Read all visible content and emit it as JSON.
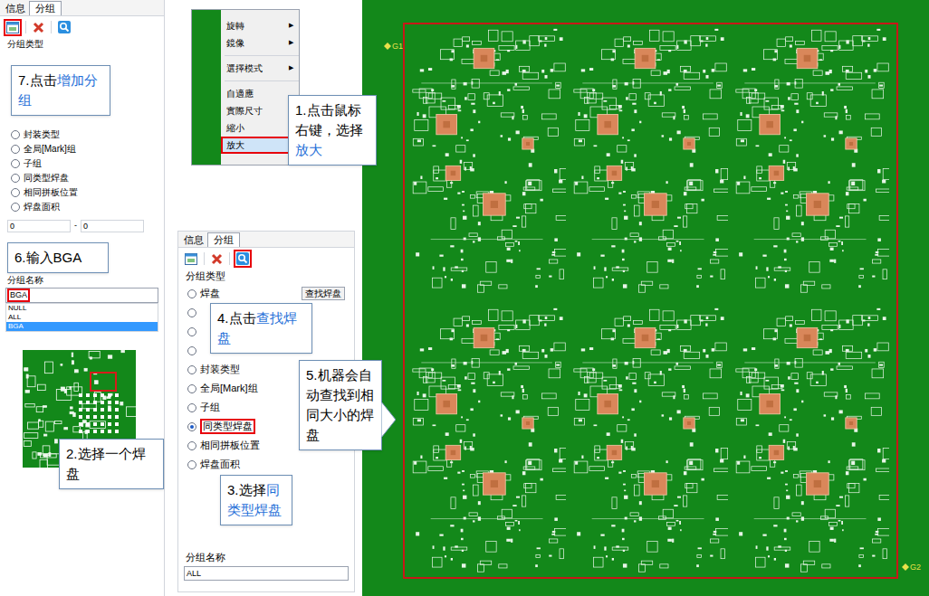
{
  "left_panel": {
    "tabs": [
      {
        "label": "信息",
        "selected": false
      },
      {
        "label": "分组",
        "selected": true
      }
    ],
    "toolbar": {
      "add_highlighted": true,
      "delete_highlighted": false,
      "search_highlighted": false
    },
    "group_type_label": "分组类型",
    "radios": [
      {
        "label": "封装类型",
        "selected": false
      },
      {
        "label": "全局[Mark]组",
        "selected": false
      },
      {
        "label": "子组",
        "selected": false
      },
      {
        "label": "同类型焊盘",
        "selected": false
      },
      {
        "label": "相同拼板位置",
        "selected": false
      },
      {
        "label": "焊盘面积",
        "selected": false
      }
    ],
    "area_range": {
      "min": "0",
      "separator": "-",
      "max": "0"
    },
    "group_name_label": "分组名称",
    "group_name_input": {
      "value": "BGA",
      "highlighted": true
    },
    "group_list": [
      {
        "label": "NULL",
        "selected": false
      },
      {
        "label": "ALL",
        "selected": false
      },
      {
        "label": "BGA",
        "selected": true
      }
    ],
    "thumbnail": {
      "highlighted": true
    }
  },
  "context_menu": {
    "items": [
      {
        "kind": "item",
        "label": "旋轉",
        "arrow": "▶",
        "selected": false
      },
      {
        "kind": "item",
        "label": "鏡像",
        "arrow": "▶",
        "selected": false
      },
      {
        "kind": "separator",
        "label": "",
        "arrow": "",
        "selected": false
      },
      {
        "kind": "item",
        "label": "選擇模式",
        "arrow": "▶",
        "selected": false
      },
      {
        "kind": "separator",
        "label": "",
        "arrow": "",
        "selected": false
      },
      {
        "kind": "item",
        "label": "自適應",
        "arrow": "",
        "selected": false
      },
      {
        "kind": "item",
        "label": "實際尺寸",
        "arrow": "",
        "selected": false
      },
      {
        "kind": "item",
        "label": "縮小",
        "arrow": "",
        "selected": false
      },
      {
        "kind": "item",
        "label": "放大",
        "arrow": "",
        "selected": true
      }
    ]
  },
  "middle_panel": {
    "tabs": [
      {
        "label": "信息",
        "selected": false
      },
      {
        "label": "分组",
        "selected": true
      }
    ],
    "toolbar": {
      "add_highlighted": false,
      "delete_highlighted": false,
      "search_highlighted": true
    },
    "group_type_label": "分组类型",
    "radios": [
      {
        "label": "焊盘",
        "selected": false,
        "highlighted": false,
        "button": "查找焊盘"
      },
      {
        "label": "",
        "selected": false,
        "highlighted": false,
        "button": ""
      },
      {
        "label": "",
        "selected": false,
        "highlighted": false,
        "button": ""
      },
      {
        "label": "",
        "selected": false,
        "highlighted": false,
        "button": ""
      },
      {
        "label": "封装类型",
        "selected": false,
        "highlighted": false,
        "button": ""
      },
      {
        "label": "全局[Mark]组",
        "selected": false,
        "highlighted": false,
        "button": ""
      },
      {
        "label": "子组",
        "selected": false,
        "highlighted": false,
        "button": ""
      },
      {
        "label": "同类型焊盘",
        "selected": true,
        "highlighted": true,
        "button": ""
      },
      {
        "label": "相同拼板位置",
        "selected": false,
        "highlighted": false,
        "button": ""
      },
      {
        "label": "焊盘面积",
        "selected": false,
        "highlighted": false,
        "button": ""
      }
    ],
    "group_name_label": "分组名称",
    "group_name_input": {
      "value": "ALL"
    }
  },
  "canvas": {
    "markers": [
      {
        "label": "G1"
      },
      {
        "label": "G2"
      }
    ]
  },
  "callouts": [
    {
      "parts": [
        {
          "text": "1.点击鼠标右键，选择",
          "highlight": false
        },
        {
          "text": "放大",
          "highlight": true
        }
      ]
    },
    {
      "parts": [
        {
          "text": "2.选择一个焊盘",
          "highlight": false
        }
      ]
    },
    {
      "parts": [
        {
          "text": "3.选择",
          "highlight": false
        },
        {
          "text": "同类型焊盘",
          "highlight": true
        }
      ]
    },
    {
      "parts": [
        {
          "text": "4.点击",
          "highlight": false
        },
        {
          "text": "查找焊盘",
          "highlight": true
        }
      ]
    },
    {
      "parts": [
        {
          "text": "5.机器会自动查找到相同大小的焊盘",
          "highlight": false
        }
      ]
    },
    {
      "parts": [
        {
          "text": "6.输入BGA",
          "highlight": false
        }
      ]
    },
    {
      "parts": [
        {
          "text": "7.点击",
          "highlight": false
        },
        {
          "text": "增加分组",
          "highlight": true
        }
      ]
    }
  ]
}
